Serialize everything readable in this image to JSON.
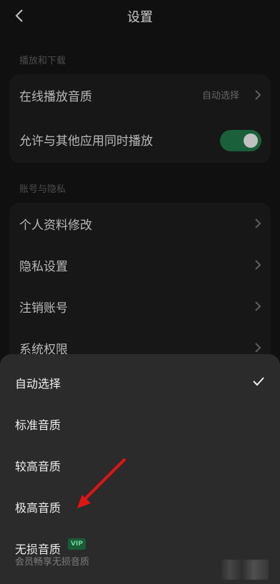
{
  "header": {
    "title": "设置"
  },
  "sections": [
    {
      "label": "播放和下载",
      "rows": [
        {
          "label": "在线播放音质",
          "value": "自动选择"
        },
        {
          "label": "允许与其他应用同时播放",
          "toggle": "on"
        }
      ]
    },
    {
      "label": "账号与隐私",
      "rows": [
        {
          "label": "个人资料修改"
        },
        {
          "label": "隐私设置"
        },
        {
          "label": "注销账号"
        },
        {
          "label": "系统权限"
        }
      ]
    }
  ],
  "sheet": {
    "options": [
      {
        "label": "自动选择",
        "selected": true
      },
      {
        "label": "标准音质"
      },
      {
        "label": "较高音质"
      },
      {
        "label": "极高音质"
      },
      {
        "label": "无损音质",
        "badge": "VIP",
        "sub": "会员畅享无损音质"
      }
    ]
  },
  "colors": {
    "background": "#121212",
    "card": "#1a1a1a",
    "sheet": "#2b2b2b",
    "toggle_on": "#1e6b42",
    "arrow_red": "#e11414",
    "vip_badge_bg": "#1a5b39",
    "vip_badge_text": "#6fd39a"
  },
  "icons": {
    "back": "back-icon",
    "chevron": "chevron-right-icon",
    "check": "check-icon",
    "annotation": "red-arrow"
  }
}
